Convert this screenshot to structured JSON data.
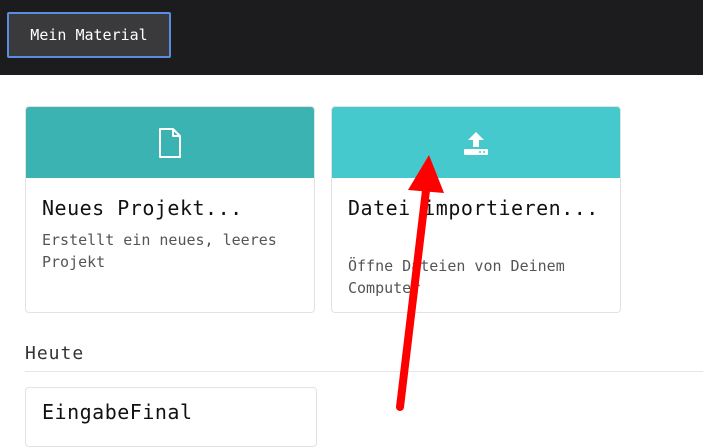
{
  "topbar": {
    "button_label": "Mein Material"
  },
  "cards": {
    "new_project": {
      "title": "Neues Projekt...",
      "description": "Erstellt ein neues, leeres Projekt",
      "icon": "file-icon",
      "color": "#3cb3b3"
    },
    "import_file": {
      "title": "Datei importieren...",
      "description": "Öffne Dateien von Deinem Computer",
      "icon": "upload-icon",
      "color": "#45c9cc"
    }
  },
  "sections": {
    "today": {
      "title": "Heute",
      "projects": [
        {
          "title": "EingabeFinal"
        }
      ]
    }
  },
  "annotation": {
    "arrow_color": "#ff0000"
  }
}
